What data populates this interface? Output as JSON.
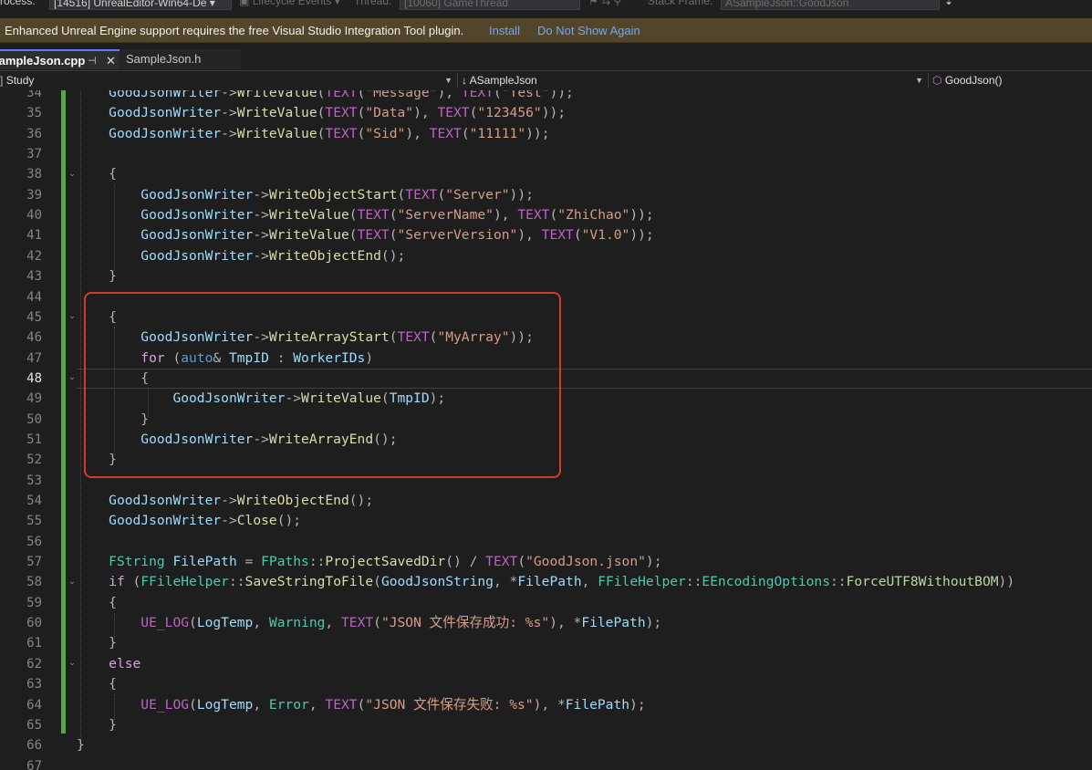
{
  "toolbar": {
    "process_label": "Process:",
    "process_value": "[14516] UnrealEditor-Win64-De",
    "lifecycle_label": "Lifecycle Events",
    "thread_label": "Thread:",
    "thread_value": "[10060] GameThread",
    "stackframe_label": "Stack Frame:",
    "stackframe_value": "ASampleJson::GoodJson"
  },
  "infobar": {
    "message": "Enhanced Unreal Engine support requires the free Visual Studio Integration Tool plugin.",
    "install_label": "Install",
    "dismiss_label": "Do Not Show Again"
  },
  "tabs": [
    {
      "label": "SampleJson.cpp",
      "active": true,
      "pin_icon": "pin-icon",
      "close_icon": "close-icon"
    },
    {
      "label": "SampleJson.h",
      "active": false
    }
  ],
  "navbar": {
    "project": "Study",
    "scope": "ASampleJson",
    "member": "GoodJson()",
    "scope_icon": "arrow-down-icon",
    "member_icon": "method-cube-icon"
  },
  "editor": {
    "current_line": "48",
    "line_numbers": [
      "34",
      "35",
      "36",
      "37",
      "38",
      "39",
      "40",
      "41",
      "42",
      "43",
      "44",
      "45",
      "46",
      "47",
      "48",
      "49",
      "50",
      "51",
      "52",
      "53",
      "54",
      "55",
      "56",
      "57",
      "58",
      "59",
      "60",
      "61",
      "62",
      "63",
      "64",
      "65",
      "66",
      "67"
    ],
    "lines": [
      [
        [
          "    ",
          "p"
        ],
        [
          "GoodJsonWriter",
          "var"
        ],
        [
          "->",
          "p"
        ],
        [
          "WriteValue",
          "fn"
        ],
        [
          "(",
          "p"
        ],
        [
          "TEXT",
          "mac"
        ],
        [
          "(",
          "p"
        ],
        [
          "\"Message\"",
          "str"
        ],
        [
          "), ",
          "p"
        ],
        [
          "TEXT",
          "mac"
        ],
        [
          "(",
          "p"
        ],
        [
          "\"Test\"",
          "str"
        ],
        [
          "));",
          "p"
        ]
      ],
      [
        [
          "    ",
          "p"
        ],
        [
          "GoodJsonWriter",
          "var"
        ],
        [
          "->",
          "p"
        ],
        [
          "WriteValue",
          "fn"
        ],
        [
          "(",
          "p"
        ],
        [
          "TEXT",
          "mac"
        ],
        [
          "(",
          "p"
        ],
        [
          "\"Data\"",
          "str"
        ],
        [
          "), ",
          "p"
        ],
        [
          "TEXT",
          "mac"
        ],
        [
          "(",
          "p"
        ],
        [
          "\"123456\"",
          "str"
        ],
        [
          "));",
          "p"
        ]
      ],
      [
        [
          "    ",
          "p"
        ],
        [
          "GoodJsonWriter",
          "var"
        ],
        [
          "->",
          "p"
        ],
        [
          "WriteValue",
          "fn"
        ],
        [
          "(",
          "p"
        ],
        [
          "TEXT",
          "mac"
        ],
        [
          "(",
          "p"
        ],
        [
          "\"Sid\"",
          "str"
        ],
        [
          "), ",
          "p"
        ],
        [
          "TEXT",
          "mac"
        ],
        [
          "(",
          "p"
        ],
        [
          "\"11111\"",
          "str"
        ],
        [
          "));",
          "p"
        ]
      ],
      [],
      [
        [
          "    {",
          "p"
        ]
      ],
      [
        [
          "        ",
          "p"
        ],
        [
          "GoodJsonWriter",
          "var"
        ],
        [
          "->",
          "p"
        ],
        [
          "WriteObjectStart",
          "fn"
        ],
        [
          "(",
          "p"
        ],
        [
          "TEXT",
          "mac"
        ],
        [
          "(",
          "p"
        ],
        [
          "\"Server\"",
          "str"
        ],
        [
          "));",
          "p"
        ]
      ],
      [
        [
          "        ",
          "p"
        ],
        [
          "GoodJsonWriter",
          "var"
        ],
        [
          "->",
          "p"
        ],
        [
          "WriteValue",
          "fn"
        ],
        [
          "(",
          "p"
        ],
        [
          "TEXT",
          "mac"
        ],
        [
          "(",
          "p"
        ],
        [
          "\"ServerName\"",
          "str"
        ],
        [
          "), ",
          "p"
        ],
        [
          "TEXT",
          "mac"
        ],
        [
          "(",
          "p"
        ],
        [
          "\"ZhiChao\"",
          "str"
        ],
        [
          "));",
          "p"
        ]
      ],
      [
        [
          "        ",
          "p"
        ],
        [
          "GoodJsonWriter",
          "var"
        ],
        [
          "->",
          "p"
        ],
        [
          "WriteValue",
          "fn"
        ],
        [
          "(",
          "p"
        ],
        [
          "TEXT",
          "mac"
        ],
        [
          "(",
          "p"
        ],
        [
          "\"ServerVersion\"",
          "str"
        ],
        [
          "), ",
          "p"
        ],
        [
          "TEXT",
          "mac"
        ],
        [
          "(",
          "p"
        ],
        [
          "\"V1.0\"",
          "str"
        ],
        [
          "));",
          "p"
        ]
      ],
      [
        [
          "        ",
          "p"
        ],
        [
          "GoodJsonWriter",
          "var"
        ],
        [
          "->",
          "p"
        ],
        [
          "WriteObjectEnd",
          "fn"
        ],
        [
          "();",
          "p"
        ]
      ],
      [
        [
          "    }",
          "p"
        ]
      ],
      [],
      [
        [
          "    {",
          "p"
        ]
      ],
      [
        [
          "        ",
          "p"
        ],
        [
          "GoodJsonWriter",
          "var"
        ],
        [
          "->",
          "p"
        ],
        [
          "WriteArrayStart",
          "fn"
        ],
        [
          "(",
          "p"
        ],
        [
          "TEXT",
          "mac"
        ],
        [
          "(",
          "p"
        ],
        [
          "\"MyArray\"",
          "str"
        ],
        [
          "));",
          "p"
        ]
      ],
      [
        [
          "        ",
          "p"
        ],
        [
          "for",
          "ctl"
        ],
        [
          " (",
          "p"
        ],
        [
          "auto",
          "kw"
        ],
        [
          "& ",
          "p"
        ],
        [
          "TmpID",
          "var"
        ],
        [
          " : ",
          "p"
        ],
        [
          "WorkerIDs",
          "var"
        ],
        [
          ")",
          "p"
        ]
      ],
      [
        [
          "        {",
          "p"
        ]
      ],
      [
        [
          "            ",
          "p"
        ],
        [
          "GoodJsonWriter",
          "var"
        ],
        [
          "->",
          "p"
        ],
        [
          "WriteValue",
          "fn"
        ],
        [
          "(",
          "p"
        ],
        [
          "TmpID",
          "var"
        ],
        [
          ");",
          "p"
        ]
      ],
      [
        [
          "        }",
          "p"
        ]
      ],
      [
        [
          "        ",
          "p"
        ],
        [
          "GoodJsonWriter",
          "var"
        ],
        [
          "->",
          "p"
        ],
        [
          "WriteArrayEnd",
          "fn"
        ],
        [
          "();",
          "p"
        ]
      ],
      [
        [
          "    }",
          "p"
        ]
      ],
      [],
      [
        [
          "    ",
          "p"
        ],
        [
          "GoodJsonWriter",
          "var"
        ],
        [
          "->",
          "p"
        ],
        [
          "WriteObjectEnd",
          "fn"
        ],
        [
          "();",
          "p"
        ]
      ],
      [
        [
          "    ",
          "p"
        ],
        [
          "GoodJsonWriter",
          "var"
        ],
        [
          "->",
          "p"
        ],
        [
          "Close",
          "fn"
        ],
        [
          "();",
          "p"
        ]
      ],
      [],
      [
        [
          "    ",
          "p"
        ],
        [
          "FString",
          "type"
        ],
        [
          " ",
          "p"
        ],
        [
          "FilePath",
          "var"
        ],
        [
          " = ",
          "p"
        ],
        [
          "FPaths",
          "type"
        ],
        [
          "::",
          "p"
        ],
        [
          "ProjectSavedDir",
          "fn"
        ],
        [
          "() / ",
          "p"
        ],
        [
          "TEXT",
          "mac"
        ],
        [
          "(",
          "p"
        ],
        [
          "\"GoodJson.json\"",
          "str"
        ],
        [
          ");",
          "p"
        ]
      ],
      [
        [
          "    ",
          "p"
        ],
        [
          "if",
          "ctl"
        ],
        [
          " (",
          "p"
        ],
        [
          "FFileHelper",
          "type"
        ],
        [
          "::",
          "p"
        ],
        [
          "SaveStringToFile",
          "fn"
        ],
        [
          "(",
          "p"
        ],
        [
          "GoodJsonString",
          "var"
        ],
        [
          ", *",
          "p"
        ],
        [
          "FilePath",
          "var"
        ],
        [
          ", ",
          "p"
        ],
        [
          "FFileHelper",
          "type"
        ],
        [
          "::",
          "p"
        ],
        [
          "EEncodingOptions",
          "type"
        ],
        [
          "::",
          "p"
        ],
        [
          "ForceUTF8WithoutBOM",
          "enum"
        ],
        [
          "))",
          "p"
        ]
      ],
      [
        [
          "    {",
          "p"
        ]
      ],
      [
        [
          "        ",
          "p"
        ],
        [
          "UE_LOG",
          "mac"
        ],
        [
          "(",
          "p"
        ],
        [
          "LogTemp",
          "var"
        ],
        [
          ", ",
          "p"
        ],
        [
          "Warning",
          "type"
        ],
        [
          ", ",
          "p"
        ],
        [
          "TEXT",
          "mac"
        ],
        [
          "(",
          "p"
        ],
        [
          "\"JSON 文件保存成功: %s\"",
          "str"
        ],
        [
          "), *",
          "p"
        ],
        [
          "FilePath",
          "var"
        ],
        [
          ");",
          "p"
        ]
      ],
      [
        [
          "    }",
          "p"
        ]
      ],
      [
        [
          "    ",
          "p"
        ],
        [
          "else",
          "ctl"
        ]
      ],
      [
        [
          "    {",
          "p"
        ]
      ],
      [
        [
          "        ",
          "p"
        ],
        [
          "UE_LOG",
          "mac"
        ],
        [
          "(",
          "p"
        ],
        [
          "LogTemp",
          "var"
        ],
        [
          ", ",
          "p"
        ],
        [
          "Error",
          "type"
        ],
        [
          ", ",
          "p"
        ],
        [
          "TEXT",
          "mac"
        ],
        [
          "(",
          "p"
        ],
        [
          "\"JSON 文件保存失败: %s\"",
          "str"
        ],
        [
          "), *",
          "p"
        ],
        [
          "FilePath",
          "var"
        ],
        [
          ");",
          "p"
        ]
      ],
      [
        [
          "    }",
          "p"
        ]
      ],
      [
        [
          "}",
          "p"
        ]
      ],
      []
    ]
  }
}
